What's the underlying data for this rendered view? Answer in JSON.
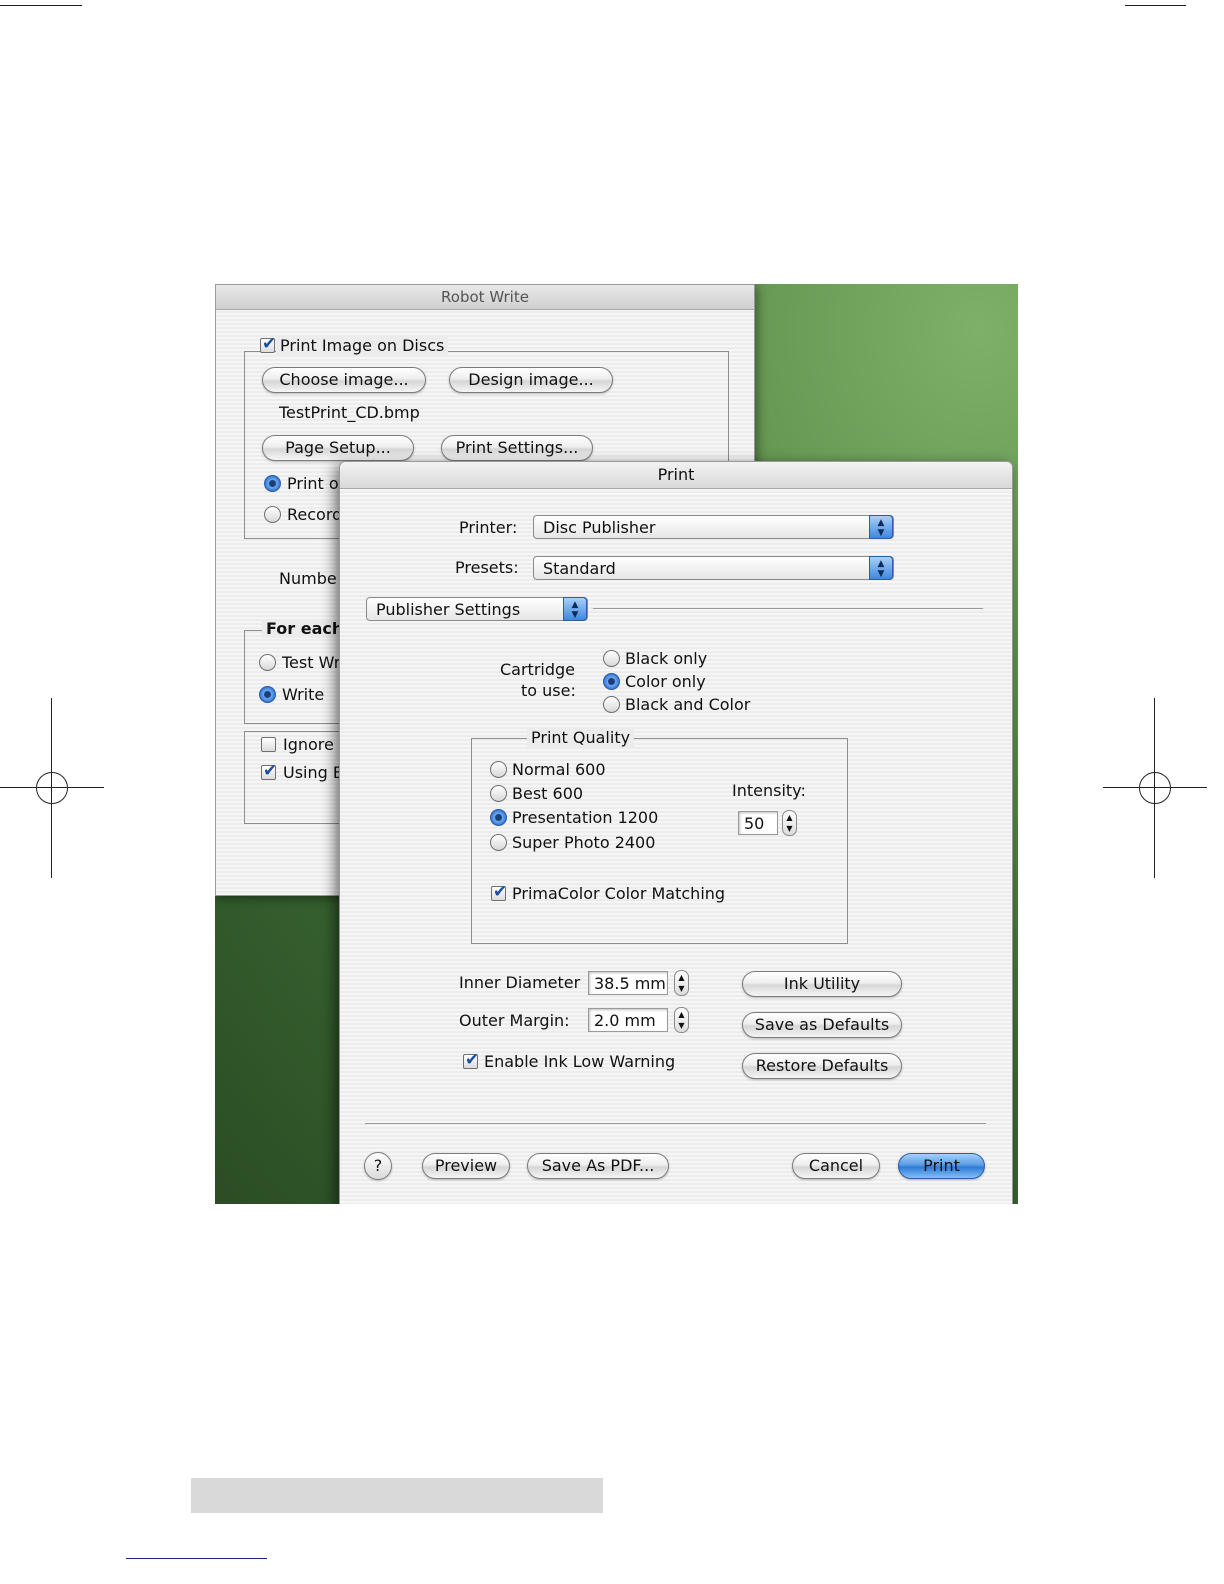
{
  "robot_write": {
    "title": "Robot Write",
    "print_image_on_discs": "Print Image on Discs",
    "choose_image": "Choose image...",
    "design_image": "Design image...",
    "filename": "TestPrint_CD.bmp",
    "page_setup": "Page Setup...",
    "print_settings": "Print Settings...",
    "radio_print": "Print o",
    "radio_record": "Record",
    "number_label": "Numbe",
    "for_each": "For each",
    "radio_test": "Test Wr",
    "radio_write": "Write",
    "chk_ignore": "Ignore",
    "chk_using": "Using B"
  },
  "print_dialog": {
    "title": "Print",
    "printer_label": "Printer:",
    "printer_value": "Disc Publisher",
    "presets_label": "Presets:",
    "presets_value": "Standard",
    "panel_value": "Publisher Settings",
    "cartridge_label_1": "Cartridge",
    "cartridge_label_2": "to use:",
    "cartridge_options": [
      "Black only",
      "Color only",
      "Black and Color"
    ],
    "cartridge_selected": "Color only",
    "quality_title": "Print Quality",
    "quality_options": [
      "Normal 600",
      "Best 600",
      "Presentation 1200",
      "Super Photo 2400"
    ],
    "quality_selected": "Presentation 1200",
    "intensity_label": "Intensity:",
    "intensity_value": "50",
    "color_matching": "PrimaColor Color Matching",
    "inner_diameter_label": "Inner Diameter",
    "inner_diameter_value": "38.5 mm",
    "outer_margin_label": "Outer Margin:",
    "outer_margin_value": "2.0 mm",
    "ink_low_warning": "Enable Ink Low Warning",
    "ink_utility": "Ink Utility",
    "save_defaults": "Save as Defaults",
    "restore_defaults": "Restore Defaults",
    "help": "?",
    "preview": "Preview",
    "save_pdf": "Save As PDF...",
    "cancel": "Cancel",
    "print": "Print"
  },
  "colors": {
    "accent": "#3f86df",
    "desktop": "#3d6b34"
  }
}
